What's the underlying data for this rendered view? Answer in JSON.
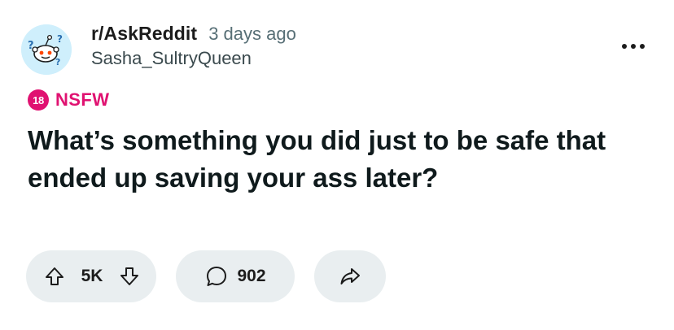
{
  "post": {
    "subreddit": "r/AskReddit",
    "time_ago": "3 days ago",
    "author": "Sasha_SultryQueen",
    "nsfw_badge": "18",
    "nsfw_label": "NSFW",
    "title": "What’s something you did just to be safe that ended up saving your ass later?"
  },
  "actions": {
    "vote_count": "5K",
    "comment_count": "902"
  },
  "icons": {
    "avatar": "askreddit-snoo-avatar",
    "more": "more-options-icon",
    "upvote": "upvote-arrow-icon",
    "downvote": "downvote-arrow-icon",
    "comment": "comment-bubble-icon",
    "share": "share-arrow-icon"
  },
  "colors": {
    "nsfw": "#e01271",
    "pill_bg": "#e9eef0",
    "avatar_bg": "#cfeffc",
    "text": "#0f1a1c",
    "muted": "#576f76"
  }
}
